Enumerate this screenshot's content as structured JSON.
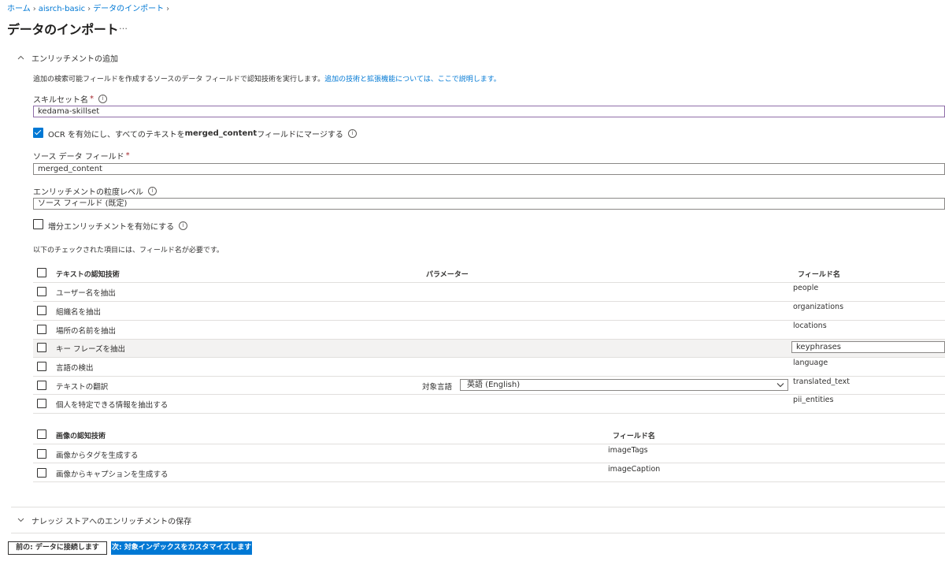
{
  "breadcrumb": {
    "home": "ホーム",
    "service": "aisrch-basic",
    "current": "データのインポート",
    "sep": "›"
  },
  "page": {
    "title": "データのインポート",
    "more": "…"
  },
  "enrichment": {
    "header": "エンリッチメントの追加",
    "chevron": "^",
    "description": "追加の検索可能フィールドを作成するソースのデータ フィールドで認知技術を実行します。",
    "description_link": "追加の技術と拡張機能については、ここで説明します。",
    "skillset_label": "スキルセット名",
    "skillset_value": "kedama-skillset",
    "ocr_label_prefix": "OCR を有効にし、すべてのテキストを ",
    "ocr_label_bold": "merged_content",
    "ocr_label_suffix": " フィールドにマージする",
    "ocr_checked": true,
    "source_label": "ソース データ フィールド",
    "source_value": "merged_content",
    "granularity_label": "エンリッチメントの粒度レベル",
    "granularity_value": "ソース フィールド (既定)",
    "incremental_label": "増分エンリッチメントを有効にする",
    "required_note": "以下のチェックされた項目には、フィールド名が必要です。",
    "required_mark": "*",
    "info_glyph": "i"
  },
  "text_skills": {
    "header": "テキストの認知技術",
    "params_header": "パラメーター",
    "field_header": "フィールド名",
    "rows": [
      {
        "label": "ユーザー名を抽出",
        "field": "people"
      },
      {
        "label": "組織名を抽出",
        "field": "organizations"
      },
      {
        "label": "場所の名前を抽出",
        "field": "locations"
      },
      {
        "label": "キー フレーズを抽出",
        "field": "keyphrases"
      },
      {
        "label": "言語の検出",
        "field": "language"
      },
      {
        "label": "テキストの翻訳",
        "field": "translated_text",
        "param_label": "対象言語",
        "param_value": "英語 (English)"
      },
      {
        "label": "個人を特定できる情報を抽出する",
        "field": "pii_entities"
      }
    ]
  },
  "image_skills": {
    "header": "画像の認知技術",
    "field_header": "フィールド名",
    "rows": [
      {
        "label": "画像からタグを生成する",
        "field": "imageTags"
      },
      {
        "label": "画像からキャプションを生成する",
        "field": "imageCaption"
      }
    ]
  },
  "knowledge_store": {
    "header": "ナレッジ ストアへのエンリッチメントの保存",
    "chevron": "v"
  },
  "footer": {
    "prev_label": "前の: データに接続します",
    "next_label": "次: 対象インデックスをカスタマイズします"
  },
  "colors": {
    "accent": "#0078d4",
    "skillset_border": "#8f6ea8",
    "required": "#a4262c"
  }
}
